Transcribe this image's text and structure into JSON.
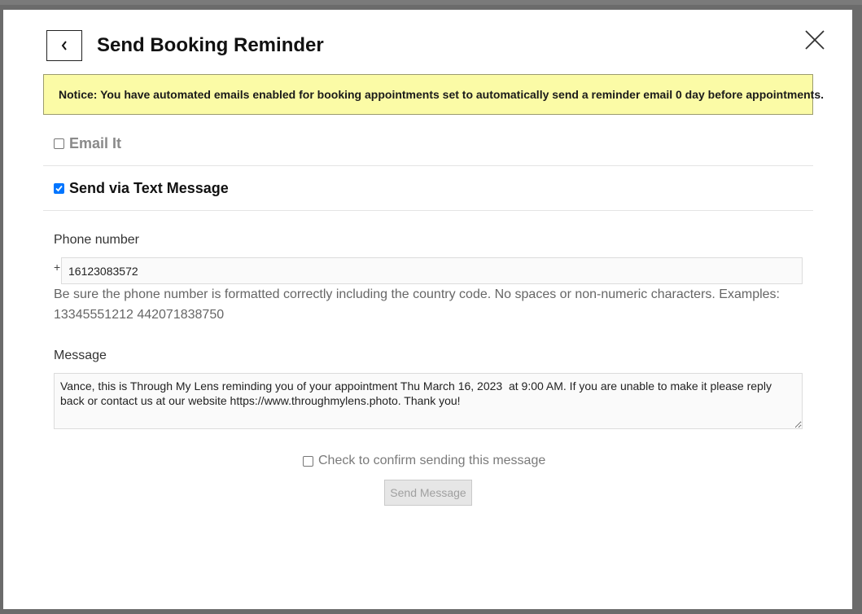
{
  "modal": {
    "title": "Send Booking Reminder",
    "back_icon": "chevron-left-icon",
    "close_icon": "close-icon"
  },
  "notice": {
    "text": "Notice: You have automated emails enabled for booking appointments set to automatically send a reminder email 0 day before appointments.",
    "background": "#fbfba6"
  },
  "options": {
    "email": {
      "label": "Email It",
      "checked": false
    },
    "sms": {
      "label": "Send via Text Message",
      "checked": true
    }
  },
  "phone": {
    "label": "Phone number",
    "prefix": "+",
    "value": "16123083572",
    "help": "Be sure the phone number is formatted correctly including the country code. No spaces or non-numeric characters. Examples: 13345551212 442071838750"
  },
  "message": {
    "label": "Message",
    "value": "Vance, this is Through My Lens reminding you of your appointment Thu March 16, 2023  at 9:00 AM. If you are unable to make it please reply back or contact us at our website https://www.throughmylens.photo. Thank you!"
  },
  "confirm": {
    "label": "Check to confirm sending this message",
    "checked": false
  },
  "send_button": {
    "label": "Send Message",
    "disabled": true
  },
  "colors": {
    "checkbox_checked": "#0075ff",
    "muted_text": "#8a8a8a"
  }
}
